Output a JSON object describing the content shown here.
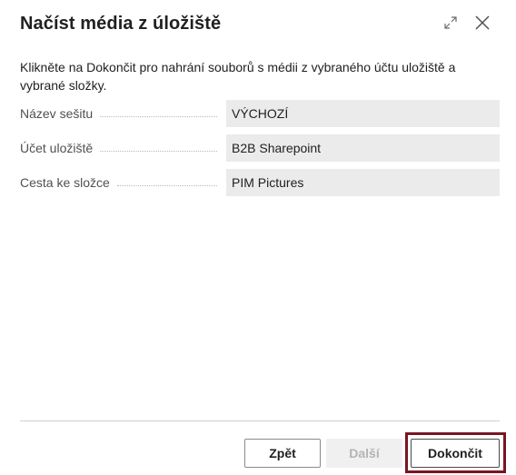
{
  "dialog": {
    "title": "Načíst média z úložiště",
    "instruction": "Klikněte na Dokončit pro nahrání souborů s médii z vybraného účtu uložiště a vybrané složky.",
    "icons": {
      "expand": "expand-icon",
      "close": "close-icon"
    }
  },
  "fields": [
    {
      "label": "Název sešitu",
      "value": "VÝCHOZÍ"
    },
    {
      "label": "Účet uložiště",
      "value": "B2B Sharepoint"
    },
    {
      "label": "Cesta ke složce",
      "value": "PIM Pictures"
    }
  ],
  "footer": {
    "back_label": "Zpět",
    "next_label": "Další",
    "finish_label": "Dokončit"
  },
  "colors": {
    "highlight": "#7a1523",
    "field_background": "#ebebeb"
  }
}
